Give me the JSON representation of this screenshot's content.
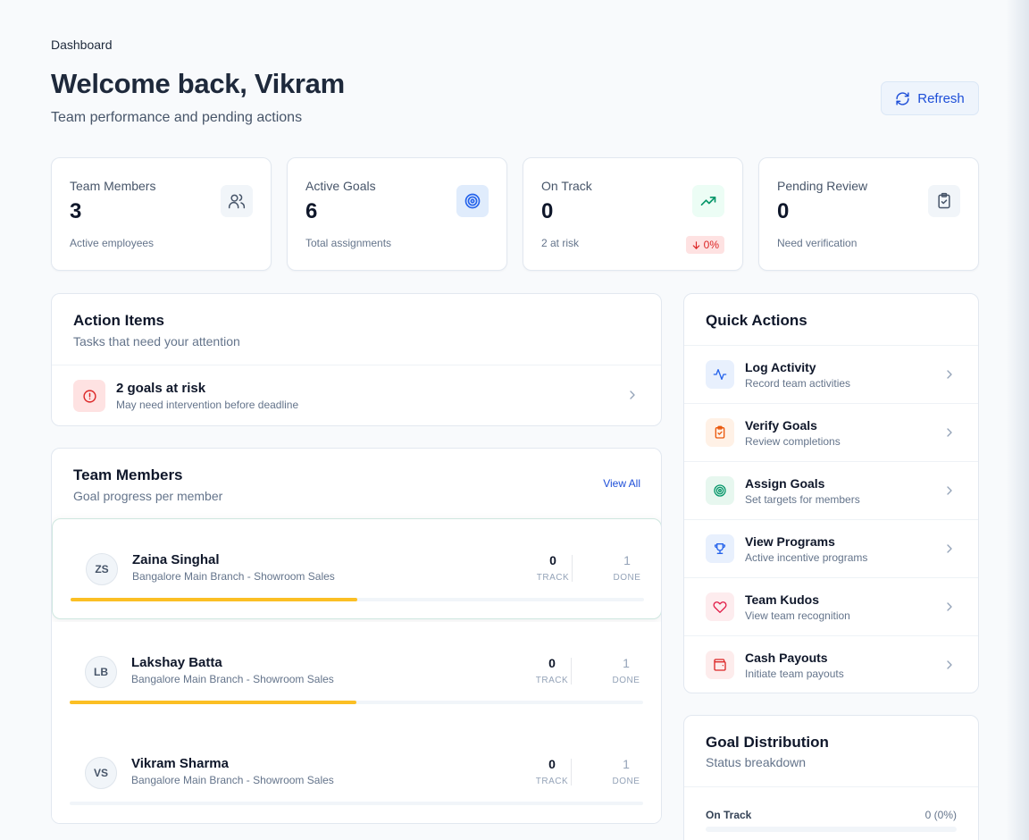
{
  "header": {
    "breadcrumb": "Dashboard",
    "title": "Welcome back, Vikram",
    "subtitle": "Team performance and pending actions",
    "refresh_label": "Refresh"
  },
  "stats": [
    {
      "label": "Team Members",
      "value": "3",
      "hint": "Active employees",
      "icon": "users-icon"
    },
    {
      "label": "Active Goals",
      "value": "6",
      "hint": "Total assignments",
      "icon": "target-icon"
    },
    {
      "label": "On Track",
      "value": "0",
      "hint": "2 at risk",
      "icon": "trending-up-icon",
      "badge": "0%"
    },
    {
      "label": "Pending Review",
      "value": "0",
      "hint": "Need verification",
      "icon": "clipboard-check-icon"
    }
  ],
  "action_items": {
    "title": "Action Items",
    "subtitle": "Tasks that need your attention",
    "items": [
      {
        "title": "2 goals at risk",
        "description": "May need intervention before deadline",
        "icon": "alert-circle-icon"
      }
    ]
  },
  "team": {
    "title": "Team Members",
    "subtitle": "Goal progress per member",
    "view_all": "View All",
    "track_label": "TRACK",
    "done_label": "DONE",
    "members": [
      {
        "initials": "ZS",
        "name": "Zaina Singhal",
        "branch": "Bangalore Main Branch - Showroom Sales",
        "track": "0",
        "done": "1",
        "progress": 0.5
      },
      {
        "initials": "LB",
        "name": "Lakshay Batta",
        "branch": "Bangalore Main Branch - Showroom Sales",
        "track": "0",
        "done": "1",
        "progress": 0.5
      },
      {
        "initials": "VS",
        "name": "Vikram Sharma",
        "branch": "Bangalore Main Branch - Showroom Sales",
        "track": "0",
        "done": "1",
        "progress": 0
      }
    ]
  },
  "quick_actions": {
    "title": "Quick Actions",
    "items": [
      {
        "title": "Log Activity",
        "subtitle": "Record team activities",
        "icon": "activity-icon"
      },
      {
        "title": "Verify Goals",
        "subtitle": "Review completions",
        "icon": "clipboard-check-icon"
      },
      {
        "title": "Assign Goals",
        "subtitle": "Set targets for members",
        "icon": "target-icon"
      },
      {
        "title": "View Programs",
        "subtitle": "Active incentive programs",
        "icon": "trophy-icon"
      },
      {
        "title": "Team Kudos",
        "subtitle": "View team recognition",
        "icon": "heart-icon"
      },
      {
        "title": "Cash Payouts",
        "subtitle": "Initiate team payouts",
        "icon": "wallet-icon"
      }
    ]
  },
  "distribution": {
    "title": "Goal Distribution",
    "subtitle": "Status breakdown",
    "rows": [
      {
        "label": "On Track",
        "value": "0 (0%)"
      }
    ]
  },
  "colors": {
    "accent": "#1d4ed8",
    "progress": "#fbbf24",
    "danger": "#dc2626",
    "success": "#059669"
  }
}
